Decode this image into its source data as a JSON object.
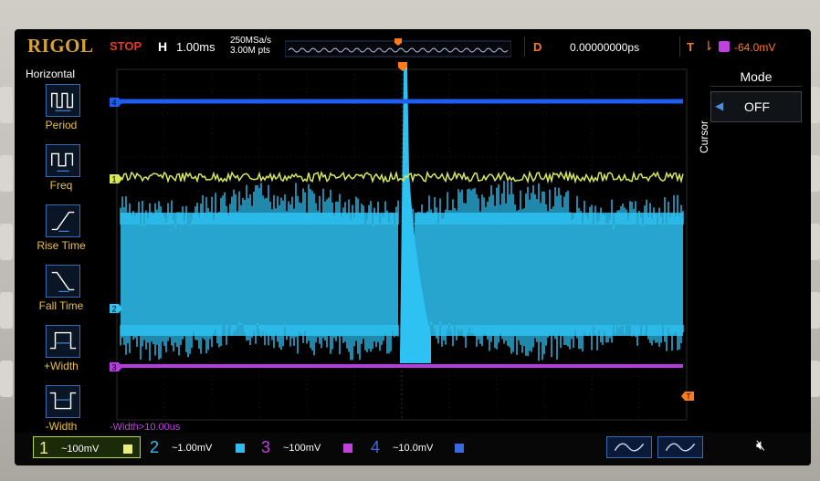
{
  "header": {
    "brand": "RIGOL",
    "run_state": "STOP",
    "horizontal_label": "H",
    "timebase": "1.00ms",
    "sample_rate": "250MSa/s",
    "memory_depth": "3.00M pts",
    "delay_label": "D",
    "delay_value": "0.00000000ps",
    "trigger_label": "T",
    "trigger_level": "-64.0mV"
  },
  "left_menu": {
    "title": "Horizontal",
    "items": [
      {
        "label": "Period",
        "icon": "period-icon"
      },
      {
        "label": "Freq",
        "icon": "freq-icon"
      },
      {
        "label": "Rise Time",
        "icon": "rise-time-icon"
      },
      {
        "label": "Fall Time",
        "icon": "fall-time-icon"
      },
      {
        "label": "+Width",
        "icon": "positive-width-icon"
      },
      {
        "label": "-Width",
        "icon": "negative-width-icon"
      }
    ]
  },
  "right_menu": {
    "side_label": "Cursor",
    "mode_title": "Mode",
    "mode_value": "OFF"
  },
  "plot": {
    "marker_labels": [
      "4",
      "1",
      "2",
      "3",
      "T"
    ]
  },
  "measurement": "-Width>10.00us",
  "channels": [
    {
      "num": "1",
      "scale": "~100mV",
      "color": "#e6f07a"
    },
    {
      "num": "2",
      "scale": "~1.00mV",
      "color": "#33bbee"
    },
    {
      "num": "3",
      "scale": "~100mV",
      "color": "#c040e0"
    },
    {
      "num": "4",
      "scale": "~10.0mV",
      "color": "#3a6ae0"
    }
  ],
  "colors": {
    "ch1": "#d6e85a",
    "ch2": "#2ec2f2",
    "ch3": "#b43ce0",
    "ch4": "#1e5ef0",
    "trigger": "#ff7a1a"
  }
}
